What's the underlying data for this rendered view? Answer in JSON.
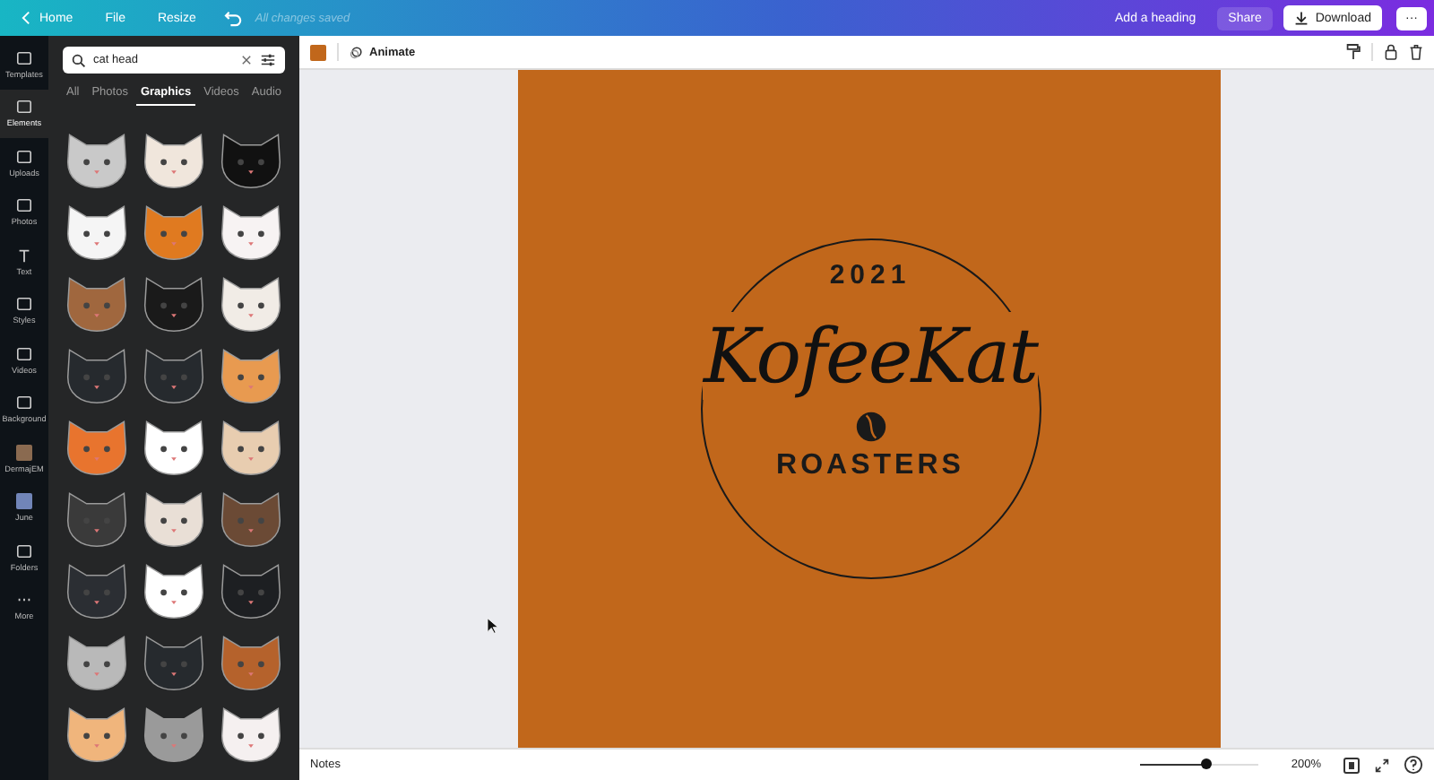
{
  "top_bar": {
    "home": "Home",
    "menu": [
      "File",
      "Resize"
    ],
    "save_status": "All changes saved",
    "heading": "Add a heading",
    "share": "Share",
    "download": "Download",
    "more": "···"
  },
  "rail": [
    {
      "label": "Templates",
      "selected": false
    },
    {
      "label": "Elements",
      "selected": true
    },
    {
      "label": "Uploads",
      "selected": false
    },
    {
      "label": "Photos",
      "selected": false
    },
    {
      "label": "Text",
      "selected": false
    },
    {
      "label": "Styles",
      "selected": false
    },
    {
      "label": "Videos",
      "selected": false
    },
    {
      "label": "Background",
      "selected": false
    },
    {
      "label": "DermajEM",
      "selected": false
    },
    {
      "label": "June",
      "selected": false
    },
    {
      "label": "Folders",
      "selected": false
    },
    {
      "label": "More",
      "selected": false
    }
  ],
  "search": {
    "value": "cat head"
  },
  "tabs": [
    {
      "label": "All",
      "selected": false
    },
    {
      "label": "Photos",
      "selected": false
    },
    {
      "label": "Graphics",
      "selected": true
    },
    {
      "label": "Videos",
      "selected": false
    },
    {
      "label": "Audio",
      "selected": false
    }
  ],
  "graphics": [
    {
      "color": "#c9c9c9"
    },
    {
      "color": "#f0e6dc"
    },
    {
      "color": "#111111"
    },
    {
      "color": "#f5f5f5"
    },
    {
      "color": "#e07a20"
    },
    {
      "color": "#f7f3f3"
    },
    {
      "color": "#a0673e"
    },
    {
      "color": "#1a1a1a"
    },
    {
      "color": "#f1ece6"
    },
    {
      "color": "#262a2e"
    },
    {
      "color": "#262a2e"
    },
    {
      "color": "#e89a50"
    },
    {
      "color": "#e8742e"
    },
    {
      "color": "#ffffff"
    },
    {
      "color": "#e8cdb0"
    },
    {
      "color": "#3a3a3a"
    },
    {
      "color": "#e9dfd6"
    },
    {
      "color": "#6b4a35"
    },
    {
      "color": "#2b2e33"
    },
    {
      "color": "#ffffff"
    },
    {
      "color": "#1d1f22"
    },
    {
      "color": "#b9b9b9"
    },
    {
      "color": "#262a2e"
    },
    {
      "color": "#b5622c"
    },
    {
      "color": "#f0b57c"
    },
    {
      "color": "#9a9a9a"
    },
    {
      "color": "#f5f0f0"
    }
  ],
  "toolbar": {
    "color": "#c1671b",
    "animate": "Animate"
  },
  "design": {
    "year": "2021",
    "brand": "KofeeKat",
    "tagline": "ROASTERS"
  },
  "bottom_bar": {
    "notes": "Notes",
    "zoom": {
      "level": 0.55
    },
    "zoom_reading": "200%"
  }
}
